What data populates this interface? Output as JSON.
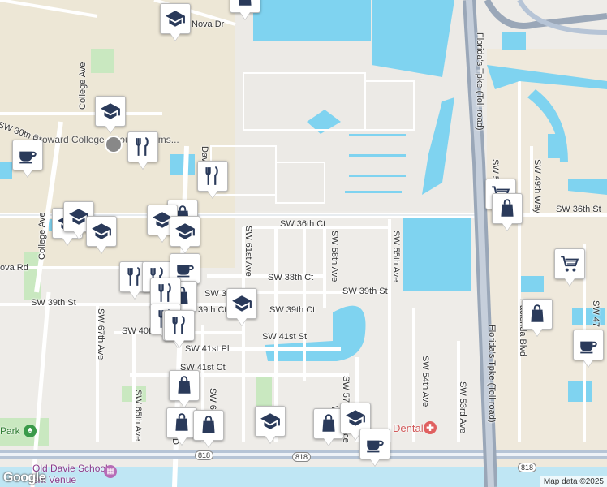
{
  "map": {
    "attribution": "Map data ©2025",
    "logo": "Google"
  },
  "streets": {
    "nova_dr": "Nova Dr",
    "college_ave": "College Ave",
    "sw_30th_st": "SW 30th St",
    "davie_rd": "Davie Rd",
    "sw_36th_ct": "SW 36th Ct",
    "sw_36th_st": "SW 36th St",
    "nova_rd": "ova Rd",
    "sw_39th_st_west": "SW 39th St",
    "sw_39_short": "SW 39",
    "sw_39th_ct_west": "39th Ct",
    "sw_40th": "SW 40th",
    "sw_38th_ct": "SW 38th Ct",
    "sw_39th_ct": "SW 39th Ct",
    "sw_39th_st_east": "SW 39th St",
    "sw_41st_st": "SW 41st St",
    "sw_41st_pl": "SW 41st Pl",
    "sw_41st_ct": "SW 41st Ct",
    "sw_61st_ave": "SW 61st Ave",
    "sw_58th_ave": "SW 58th Ave",
    "sw_55th_ave": "SW 55th Ave",
    "sw_54th_ave": "SW 54th Ave",
    "sw_53rd_ave": "SW 53rd Ave",
    "sw_67th_ave": "SW 67th Ave",
    "sw_65th_ave": "SW 65th Ave",
    "sw_64th": "SW 64th Ave Rd",
    "sw_63rd": "SW 63rd Ave",
    "sw_6_short": "SW 6",
    "sw_57": "SW 57",
    "hacienda_blvd": "Hacienda Blvd",
    "sw_49th_way": "SW 49th Way",
    "sw_5": "SW 5",
    "sw_47": "SW 47",
    "florida_tpke_1": "Florida's Tpke (Toll road)",
    "florida_tpke_2": "Florida's Tpke (Toll road)",
    "wi": "Wi",
    "ace": "ace",
    "d_rd": "D"
  },
  "places": {
    "broward_college": "Broward College - South Adams...",
    "old_davie_school": "Old Davie School",
    "event_venue": "ent Venue",
    "park": "Park",
    "dental": "Dental"
  },
  "shields": {
    "route_818_a": "818",
    "route_818_b": "818",
    "route_818_c": "818"
  },
  "pins": [
    {
      "type": "school",
      "name": "school-pin"
    },
    {
      "type": "shopping",
      "name": "shopping-pin"
    },
    {
      "type": "school",
      "name": "school-pin"
    },
    {
      "type": "cafe",
      "name": "cafe-pin"
    },
    {
      "type": "restaurant",
      "name": "restaurant-pin"
    },
    {
      "type": "restaurant",
      "name": "restaurant-pin"
    },
    {
      "type": "school",
      "name": "school-pin"
    },
    {
      "type": "school",
      "name": "school-pin"
    },
    {
      "type": "school",
      "name": "school-pin"
    },
    {
      "type": "shopping",
      "name": "shopping-pin"
    },
    {
      "type": "school",
      "name": "school-pin"
    },
    {
      "type": "school",
      "name": "school-pin"
    },
    {
      "type": "restaurant",
      "name": "restaurant-pin"
    },
    {
      "type": "restaurant",
      "name": "restaurant-pin"
    },
    {
      "type": "cafe",
      "name": "cafe-pin"
    },
    {
      "type": "shopping",
      "name": "shopping-pin"
    },
    {
      "type": "restaurant",
      "name": "restaurant-pin"
    },
    {
      "type": "restaurant",
      "name": "restaurant-pin"
    },
    {
      "type": "restaurant",
      "name": "restaurant-pin"
    },
    {
      "type": "school",
      "name": "school-pin"
    },
    {
      "type": "restaurant",
      "name": "restaurant-pin"
    },
    {
      "type": "shopping",
      "name": "shopping-pin"
    },
    {
      "type": "shopping",
      "name": "shopping-pin"
    },
    {
      "type": "shopping",
      "name": "shopping-pin"
    },
    {
      "type": "school",
      "name": "school-pin"
    },
    {
      "type": "shopping",
      "name": "shopping-pin"
    },
    {
      "type": "school",
      "name": "school-pin"
    },
    {
      "type": "cafe",
      "name": "cafe-pin"
    },
    {
      "type": "cart",
      "name": "cart-pin"
    },
    {
      "type": "shopping",
      "name": "shopping-pin"
    },
    {
      "type": "cart",
      "name": "cart-pin"
    },
    {
      "type": "shopping",
      "name": "shopping-pin"
    },
    {
      "type": "cafe",
      "name": "cafe-pin"
    }
  ],
  "colors": {
    "water": "#7fd3f0",
    "road": "#ffffff",
    "highway": "#9aa7b8",
    "campus": "#e8e4d6",
    "park": "#c9e8c0",
    "pin_icon": "#2a3a5a"
  }
}
